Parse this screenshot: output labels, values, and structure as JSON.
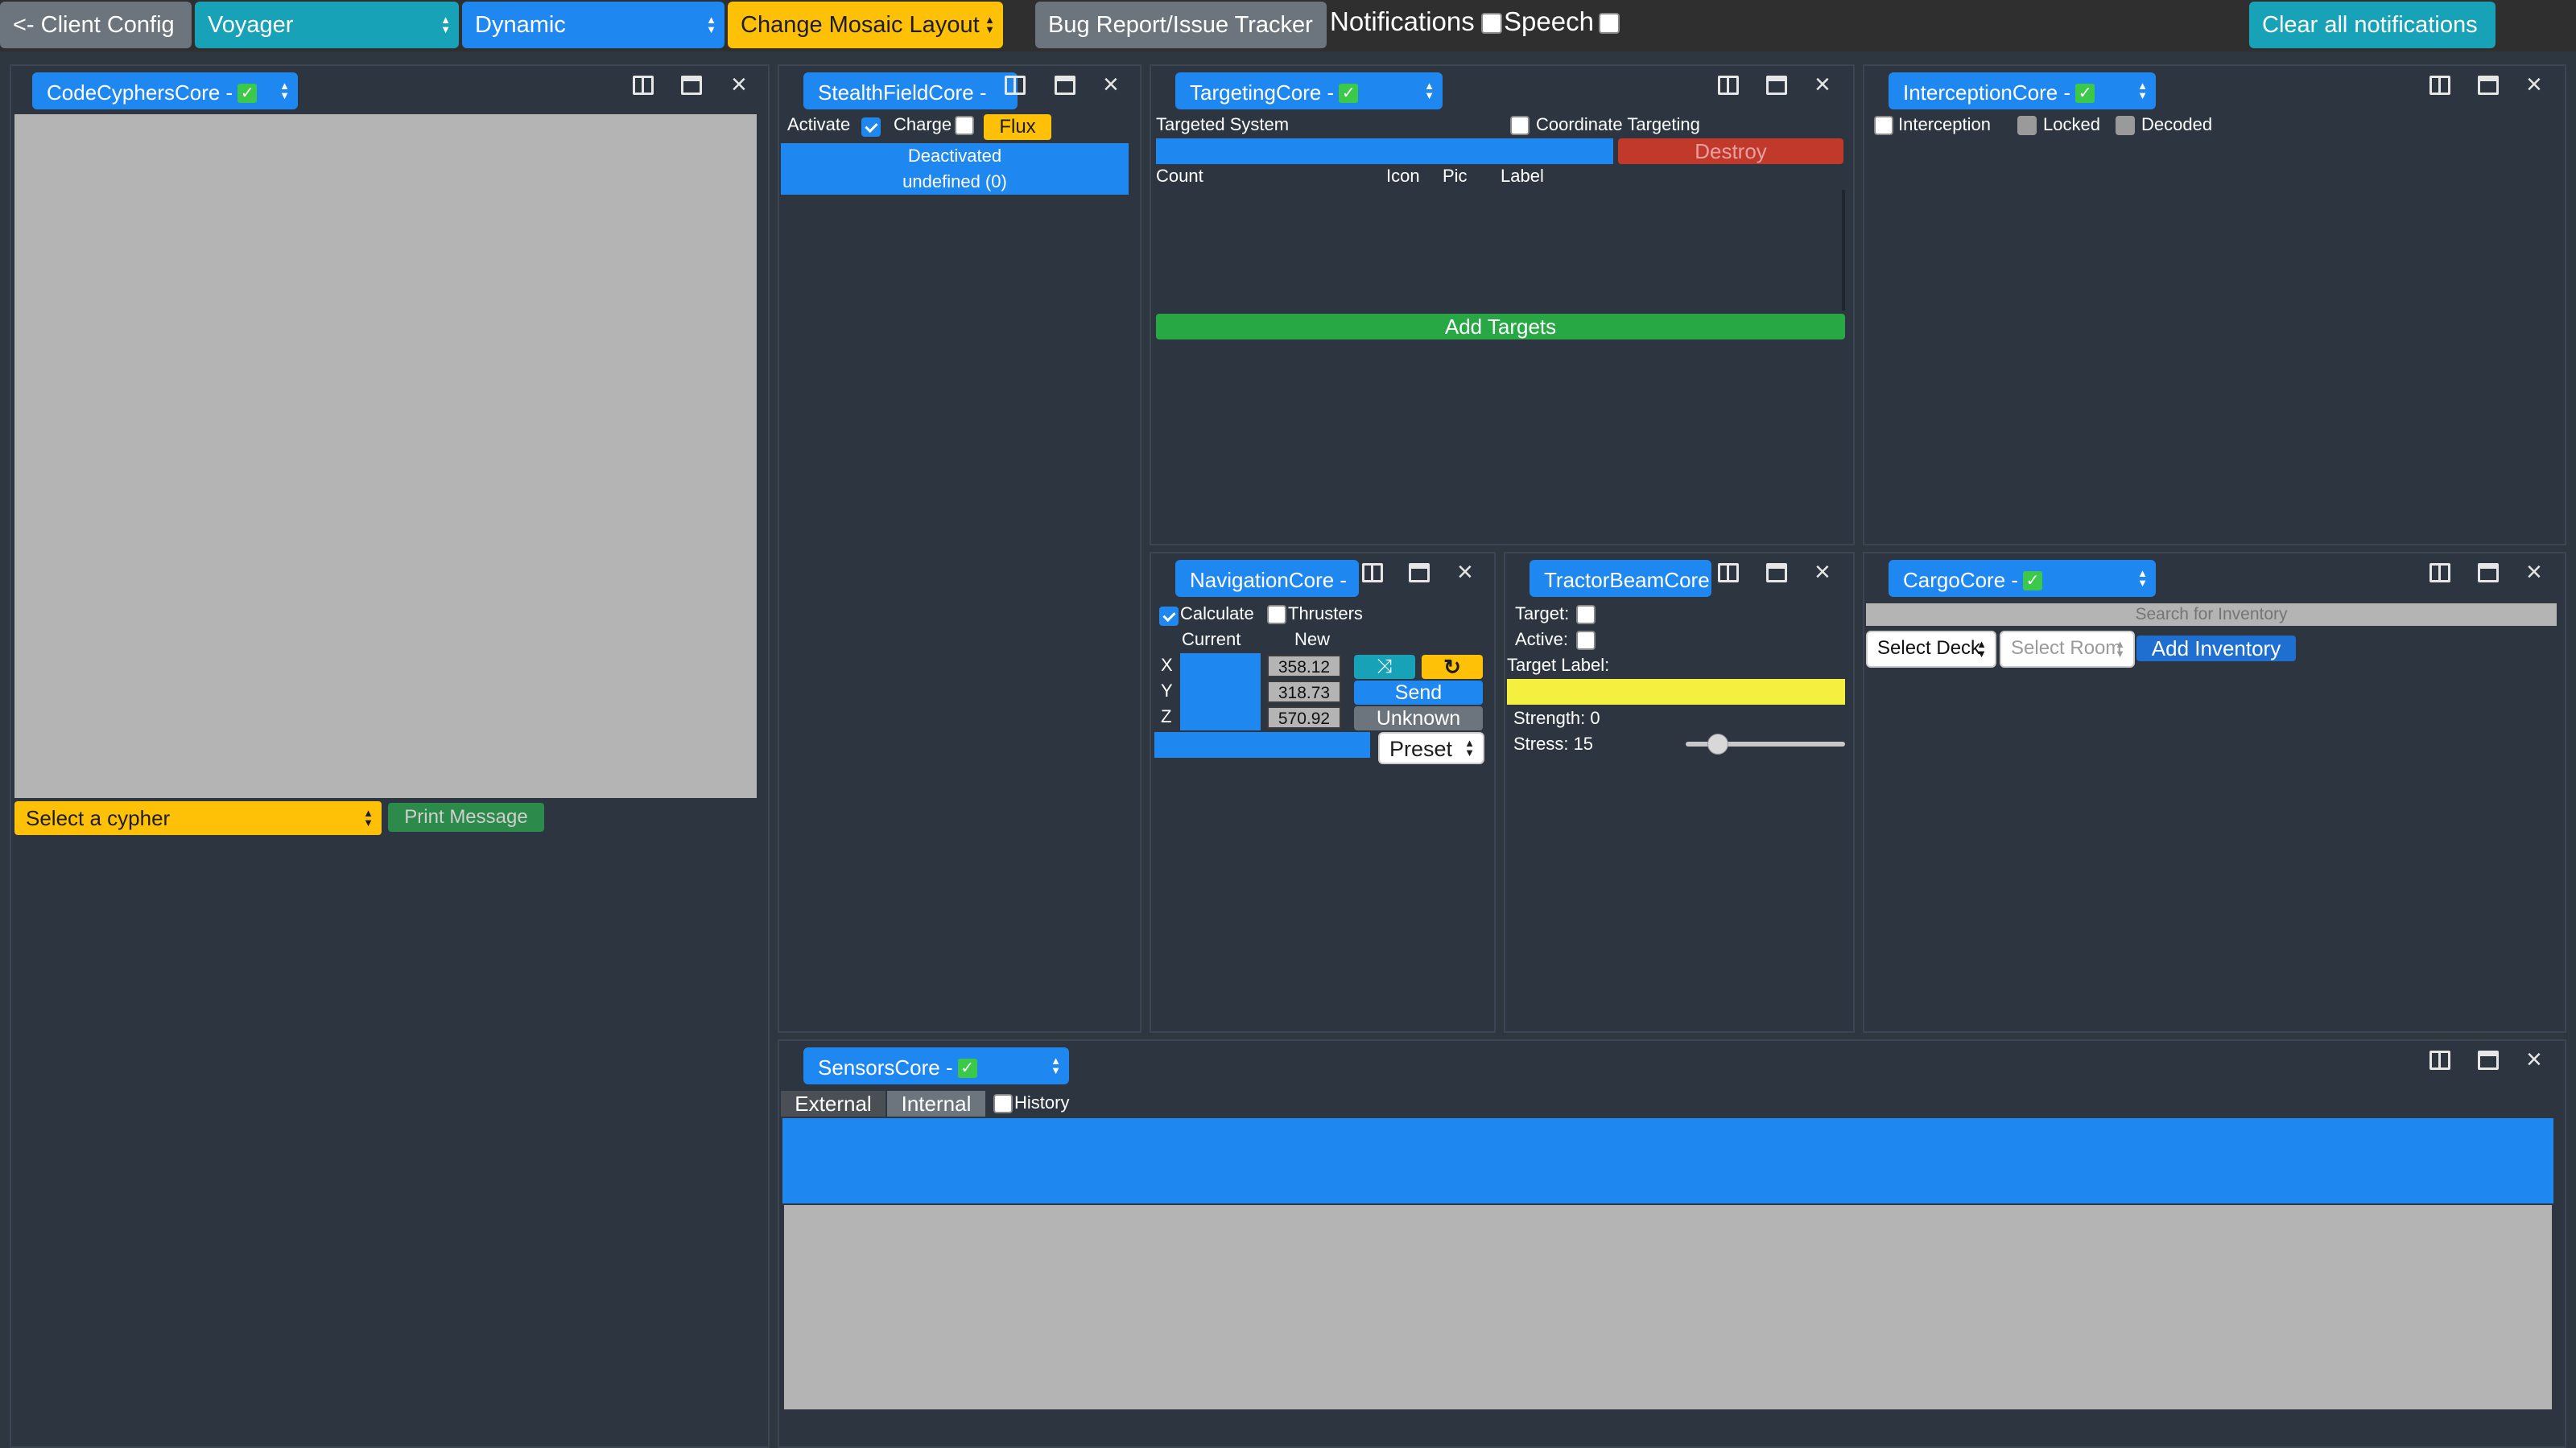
{
  "topbar": {
    "client_config": "<- Client Config",
    "simulator": "Voyager",
    "layout_mode": "Dynamic",
    "change_layout": "Change Mosaic Layout",
    "bug_report": "Bug Report/Issue Tracker",
    "notifications_label": "Notifications",
    "speech_label": "Speech",
    "clear_notifications": "Clear all notifications"
  },
  "code_cyphers": {
    "core": "CodeCyphersCore -",
    "select_cypher": "Select a cypher",
    "print_message": "Print Message"
  },
  "stealth": {
    "core": "StealthFieldCore -",
    "activate": "Activate",
    "charge": "Charge",
    "flux": "Flux",
    "status": "Deactivated",
    "undefined": "undefined (0)"
  },
  "targeting": {
    "core": "TargetingCore -",
    "targeted_system": "Targeted System",
    "coordinate_targeting": "Coordinate Targeting",
    "destroy": "Destroy",
    "columns": [
      "Count",
      "Icon",
      "Pic",
      "Label"
    ],
    "add_targets": "Add Targets"
  },
  "interception": {
    "core": "InterceptionCore -",
    "interception": "Interception",
    "locked": "Locked",
    "decoded": "Decoded"
  },
  "navigation": {
    "core": "NavigationCore -",
    "calculate": "Calculate",
    "thrusters": "Thrusters",
    "current": "Current",
    "new": "New",
    "rows": [
      {
        "axis": "X",
        "value": "358.12"
      },
      {
        "axis": "Y",
        "value": "318.73"
      },
      {
        "axis": "Z",
        "value": "570.92"
      }
    ],
    "send": "Send",
    "unknown": "Unknown",
    "preset": "Preset"
  },
  "tractor": {
    "core": "TractorBeamCore",
    "target": "Target:",
    "active": "Active:",
    "target_label": "Target Label:",
    "strength": "Strength: 0",
    "stress": "Stress: 15",
    "stress_level": 0.2
  },
  "cargo": {
    "core": "CargoCore -",
    "search_placeholder": "Search for Inventory",
    "select_deck": "Select Deck",
    "select_room": "Select Room",
    "add_inventory": "Add Inventory"
  },
  "sensors": {
    "core": "SensorsCore -",
    "external": "External",
    "internal": "Internal",
    "history": "History"
  },
  "colors": {
    "accent_blue": "#1e88f0",
    "teal": "#17a2b8",
    "yellow": "#ffc107",
    "green": "#28a745",
    "red": "#c0392b",
    "panel_bg": "#2c3540"
  }
}
